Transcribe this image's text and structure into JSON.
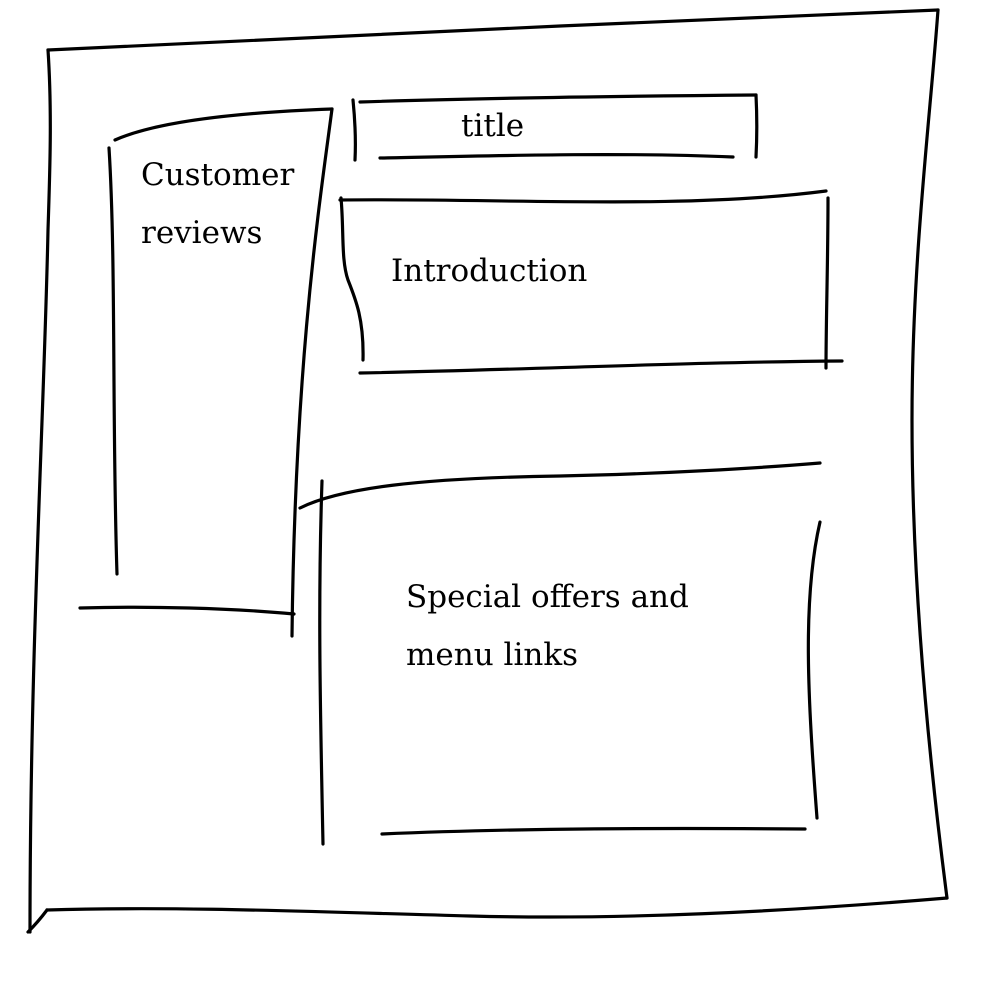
{
  "sketch": {
    "ink_color": "#000000",
    "paper_color": "#ffffff",
    "title_box": {
      "label": "title"
    },
    "reviews_panel": {
      "line1": "Customer",
      "line2": "reviews"
    },
    "intro_box": {
      "label": "Introduction"
    },
    "offers_panel": {
      "line1": "Special offers and",
      "line2": "menu links"
    }
  }
}
